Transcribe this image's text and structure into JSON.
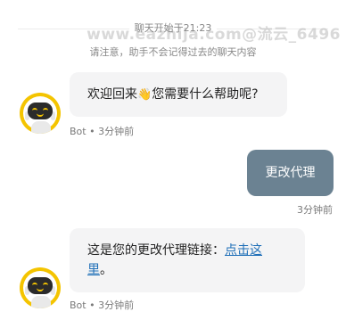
{
  "header": {
    "title": "聊天开始于21:23",
    "watermark": "www.eazhija.com@流云_6496",
    "notice": "请注意，助手不会记得过去的聊天内容"
  },
  "messages": [
    {
      "role": "bot",
      "text_before": "欢迎回来",
      "emoji": "👋",
      "text_after": "您需要什么帮助呢?",
      "sender": "Bot",
      "separator": "•",
      "time": "3分钟前"
    },
    {
      "role": "user",
      "text": "更改代理",
      "time": "3分钟前"
    },
    {
      "role": "bot",
      "text_before": "这是您的更改代理链接：",
      "link_text_1": "点击这",
      "link_text_2": "里",
      "text_after": "。",
      "sender": "Bot",
      "separator": "•",
      "time": "3分钟前"
    }
  ],
  "colors": {
    "avatar_ring": "#f4c400",
    "user_bubble": "#6b8292",
    "bot_bubble": "#f4f4f5",
    "link": "#1f6fb8"
  },
  "icons": {
    "avatar": "robot-avatar-icon",
    "wave": "waving-hand-icon"
  }
}
